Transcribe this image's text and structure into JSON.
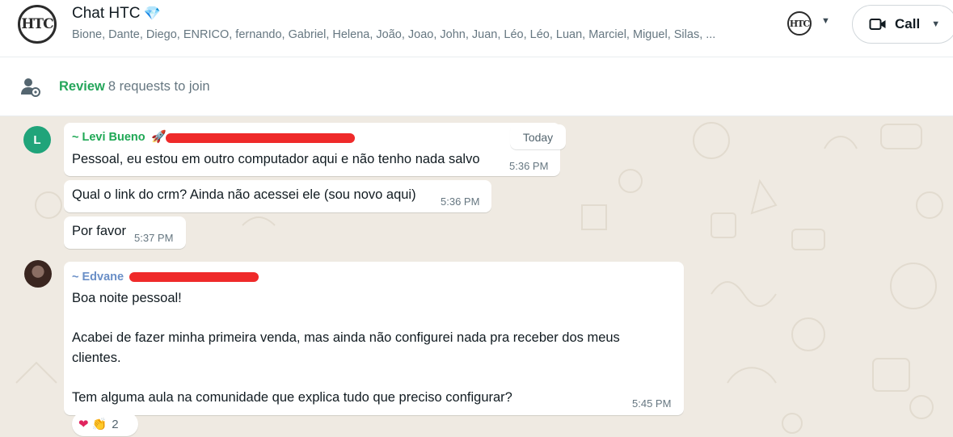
{
  "header": {
    "title": "Chat HTC",
    "title_emoji": "💎",
    "avatar_text": "HTC",
    "members": "Bione, Dante, Diego, ENRICO, fernando, Gabriel, Helena, João, Joao, John, Juan, Léo, Léo, Luan, Marciel, Miguel, Silas, ...",
    "mini_avatar_text": "HTC",
    "call_label": "Call"
  },
  "review": {
    "link": "Review",
    "text": "8 requests to join"
  },
  "chat": {
    "date_pill": "Today",
    "messages": [
      {
        "sender": "~ Levi Bueno",
        "sender_emoji": "🚀",
        "sender_color": "#1fa855",
        "avatar_letter": "L",
        "text": "Pessoal, eu estou em outro computador aqui e não tenho nada salvo",
        "time": "5:36 PM"
      },
      {
        "text": "Qual o link do crm? Ainda não acessei ele (sou novo aqui)",
        "time": "5:36 PM"
      },
      {
        "text": "Por favor",
        "time": "5:37 PM"
      },
      {
        "sender": "~ Edvane",
        "sender_color": "#6a8fc7",
        "lines": [
          "Boa noite pessoal!",
          "Acabei de fazer minha primeira venda, mas ainda não configurei nada pra receber dos meus",
          "clientes.",
          "Tem alguma aula na comunidade que explica tudo que preciso configurar?"
        ],
        "time": "5:45 PM",
        "reactions": {
          "emojis": [
            "❤",
            "👏"
          ],
          "count": "2"
        }
      }
    ]
  },
  "colors": {
    "accent": "#25a65b",
    "redaction": "#ef2a2a",
    "background": "#efeae2"
  },
  "icons": [
    "htc-logo-icon",
    "people-settings-icon",
    "video-camera-icon",
    "chevron-down-icon"
  ]
}
